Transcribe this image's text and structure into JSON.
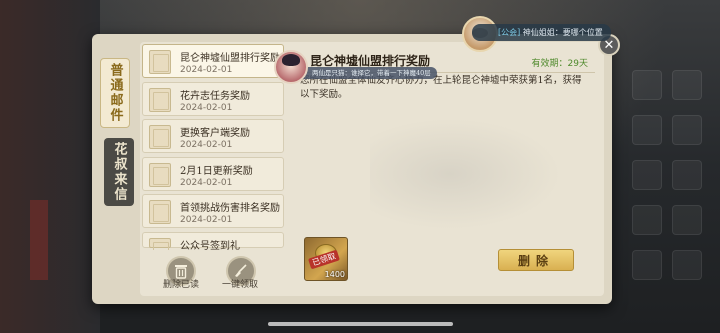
{
  "tabs": {
    "mail": "普通邮件",
    "letter": "花叔来信"
  },
  "mail_list": [
    {
      "title": "昆仑神墟仙盟排行奖励",
      "date": "2024-02-01",
      "active": true
    },
    {
      "title": "花卉志任务奖励",
      "date": "2024-02-01"
    },
    {
      "title": "更换客户端奖励",
      "date": "2024-02-01"
    },
    {
      "title": "2月1日更新奖励",
      "date": "2024-02-01"
    },
    {
      "title": "首领挑战伤害排名奖励",
      "date": "2024-02-01"
    },
    {
      "title": "公众号签到礼",
      "date": ""
    }
  ],
  "list_actions": {
    "delete_read": "删除已读",
    "claim_all": "一键领取"
  },
  "detail": {
    "title": "昆仑神墟仙盟排行奖励",
    "validity": "有效期：29天",
    "body": "您所在仙盟全体仙友齐心协力，在上轮昆仑神墟中荣获第1名，获得以下奖励。",
    "reward": {
      "stamp": "已领取",
      "count": "1400"
    },
    "delete_label": "删除"
  },
  "chat_top": {
    "tag": "[公会]",
    "text": "神仙姐姐：要哪个位置"
  },
  "chat_mid": {
    "text": "两仙是只猫：谁择它，带着一下神魔40层"
  },
  "icons": {
    "close": "close-icon",
    "trash": "trash-icon",
    "broom": "broom-icon"
  }
}
